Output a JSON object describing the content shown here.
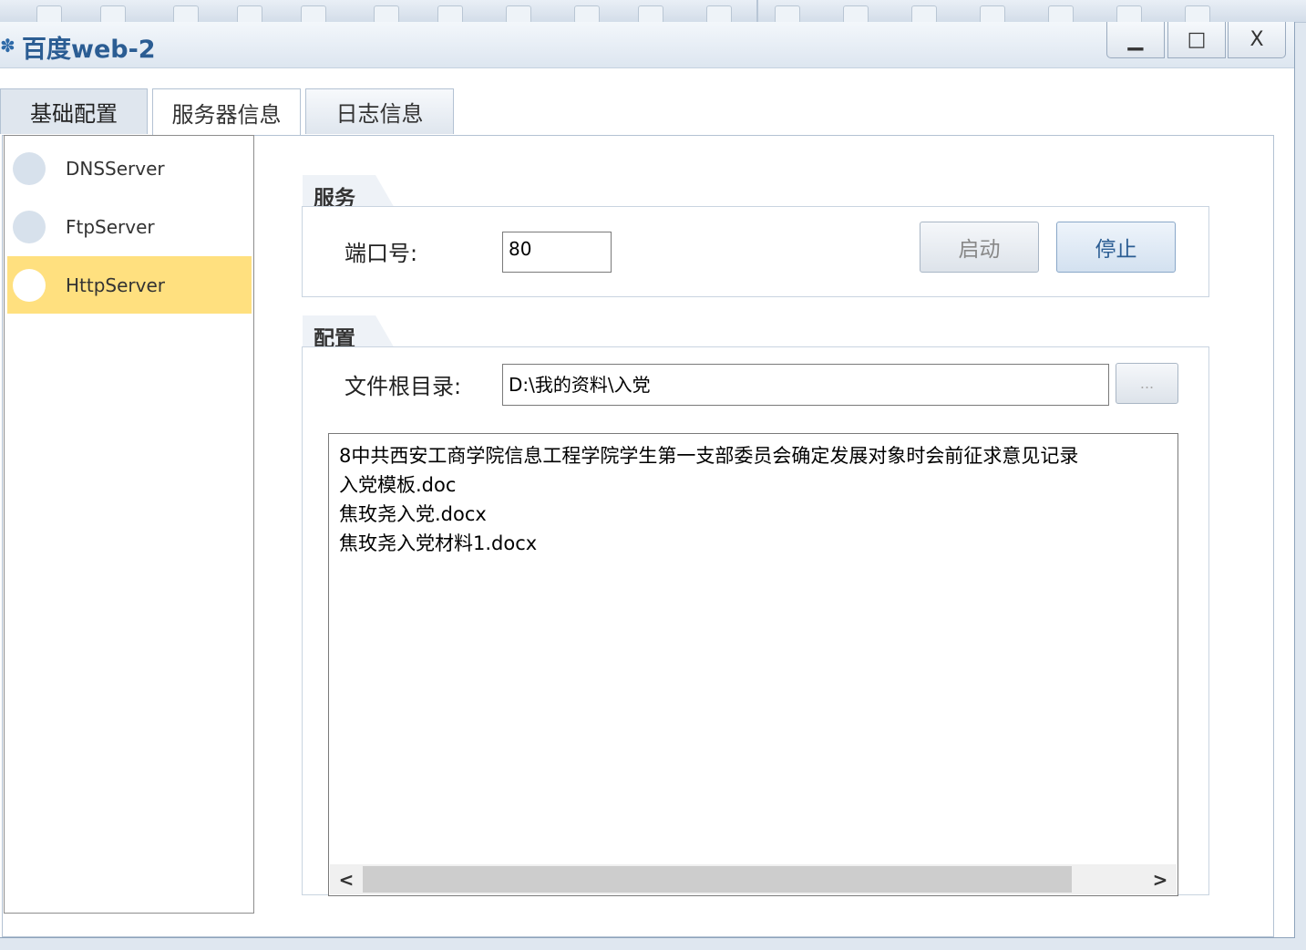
{
  "window": {
    "title": "百度web-2",
    "app_icon": "app-icon",
    "min_glyph": "▁",
    "max_glyph": "□",
    "close_glyph": "X"
  },
  "tabs": [
    {
      "label": "基础配置"
    },
    {
      "label": "服务器信息"
    },
    {
      "label": "日志信息"
    }
  ],
  "servers": [
    {
      "label": "DNSServer",
      "selected": false
    },
    {
      "label": "FtpServer",
      "selected": false
    },
    {
      "label": "HttpServer",
      "selected": true
    }
  ],
  "service_group": {
    "title": "服务",
    "port_label": "端口号:",
    "port_value": "80",
    "start_label": "启动",
    "stop_label": "停止"
  },
  "config_group": {
    "title": "配置",
    "root_label": "文件根目录:",
    "root_value": "D:\\我的资料\\入党",
    "browse_label": "..."
  },
  "files": [
    "8中共西安工商学院信息工程学院学生第一支部委员会确定发展对象时会前征求意见记录",
    "入党模板.doc",
    "焦玫尧入党.docx",
    "焦玫尧入党材料1.docx"
  ],
  "scrollbar": {
    "left_glyph": "<",
    "right_glyph": ">"
  },
  "colors": {
    "accent": "#2b5d93",
    "selected_row": "#ffe07f",
    "dot": "#d7e1ec"
  }
}
